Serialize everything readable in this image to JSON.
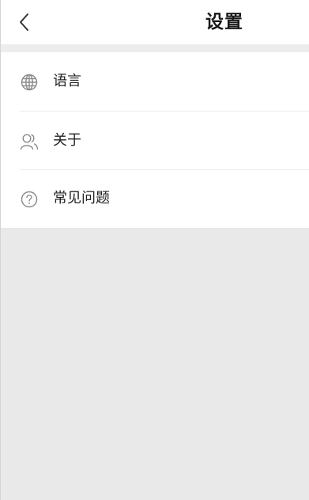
{
  "header": {
    "title": "设置",
    "back_icon": "chevron-left-icon"
  },
  "settings": {
    "items": [
      {
        "label": "语言",
        "icon": "globe-icon"
      },
      {
        "label": "关于",
        "icon": "users-icon"
      },
      {
        "label": "常见问题",
        "icon": "help-circle-icon"
      }
    ]
  },
  "colors": {
    "background": "#e9e9e9",
    "surface": "#ffffff",
    "text": "#222222",
    "icon": "#8a8a8a"
  }
}
